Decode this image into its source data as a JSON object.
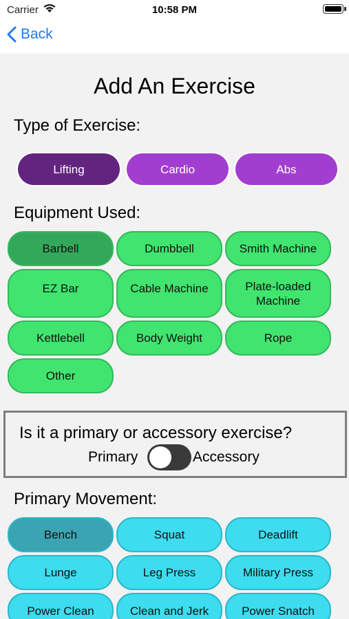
{
  "status": {
    "carrier": "Carrier",
    "time": "10:58 PM"
  },
  "nav": {
    "back_label": "Back"
  },
  "page_title": "Add An Exercise",
  "type_section": {
    "label": "Type of Exercise:",
    "options": [
      "Lifting",
      "Cardio",
      "Abs"
    ],
    "selected": "Lifting"
  },
  "equipment_section": {
    "label": "Equipment Used:",
    "options": [
      "Barbell",
      "Dumbbell",
      "Smith Machine",
      "EZ Bar",
      "Cable Machine",
      "Plate-loaded Machine",
      "Kettlebell",
      "Body Weight",
      "Rope",
      "Other"
    ],
    "selected": "Barbell"
  },
  "primary_accessory": {
    "question": "Is it a primary or accessory exercise?",
    "left_label": "Primary",
    "right_label": "Accessory",
    "toggle_on": false
  },
  "movement_section": {
    "label": "Primary Movement:",
    "options": [
      "Bench",
      "Squat",
      "Deadlift",
      "Lunge",
      "Leg Press",
      "Military Press",
      "Power Clean",
      "Clean and Jerk",
      "Power Snatch"
    ],
    "selected": "Bench"
  },
  "colors": {
    "lifting_selected": "#632480",
    "type_unselected": "#a23ecf",
    "equipment_green": "#40e46e",
    "movement_cyan": "#3ddcef",
    "link_blue": "#1a7cf3"
  }
}
